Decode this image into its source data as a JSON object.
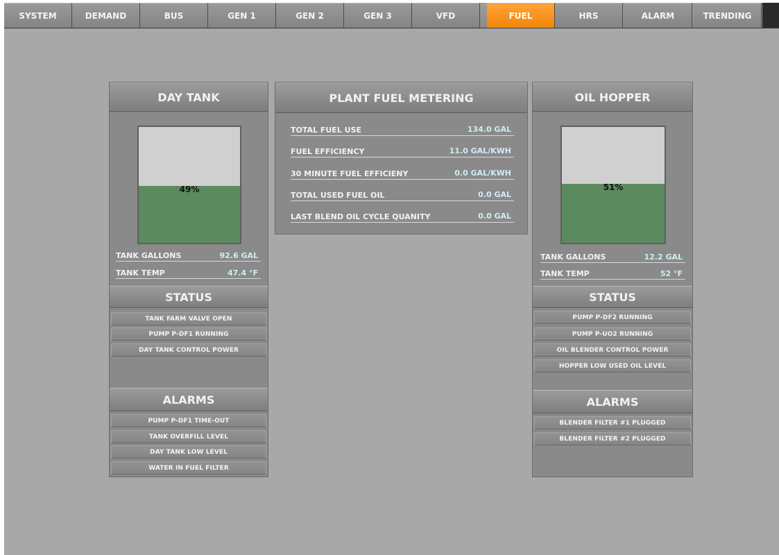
{
  "nav": {
    "tabs": [
      "SYSTEM",
      "DEMAND",
      "BUS",
      "GEN 1",
      "GEN 2",
      "GEN 3",
      "VFD",
      "FUEL",
      "HRS",
      "ALARM",
      "TRENDING"
    ],
    "active": "FUEL",
    "active_color": "#f18607"
  },
  "day_tank": {
    "title": "DAY TANK",
    "level_percent": 49,
    "level_label": "49%",
    "gallons_label": "TANK GALLONS",
    "gallons_value": "92.6 GAL",
    "temp_label": "TANK TEMP",
    "temp_value": "47.4 °F",
    "status_title": "STATUS",
    "status_items": [
      "TANK FARM VALVE OPEN",
      "PUMP P-DF1 RUNNING",
      "DAY TANK CONTROL POWER"
    ],
    "alarms_title": "ALARMS",
    "alarm_items": [
      "PUMP P-DF1 TIME-OUT",
      "TANK OVERFILL LEVEL",
      "DAY TANK LOW LEVEL",
      "WATER IN FUEL FILTER"
    ]
  },
  "metering": {
    "title": "PLANT FUEL METERING",
    "rows": [
      {
        "label": "TOTAL FUEL USE",
        "value": "134.0 GAL"
      },
      {
        "label": "FUEL EFFICIENCY",
        "value": "11.0 GAL/KWH"
      },
      {
        "label": "30 MINUTE FUEL EFFICIENY",
        "value": "0.0 GAL/KWH"
      },
      {
        "label": "TOTAL USED FUEL OIL",
        "value": "0.0 GAL"
      },
      {
        "label": "LAST BLEND OIL CYCLE QUANITY",
        "value": "0.0 GAL"
      }
    ]
  },
  "oil_hopper": {
    "title": "OIL HOPPER",
    "level_percent": 51,
    "level_label": "51%",
    "gallons_label": "TANK GALLONS",
    "gallons_value": "12.2 GAL",
    "temp_label": "TANK TEMP",
    "temp_value": "52 °F",
    "status_title": "STATUS",
    "status_items": [
      "PUMP P-DF2 RUNNING",
      "PUMP P-UO2 RUNNING",
      "OIL BLENDER CONTROL POWER",
      "HOPPER LOW USED OIL LEVEL"
    ],
    "alarms_title": "ALARMS",
    "alarm_items": [
      "BLENDER FILTER #1 PLUGGED",
      "BLENDER FILTER #2 PLUGGED"
    ]
  },
  "colors": {
    "background": "#a8a8a8",
    "panel": "#8a8a8a",
    "tank_fill": "#5b8a5e",
    "tank_empty": "#d0d0d0",
    "value_text": "#cfeef3"
  }
}
